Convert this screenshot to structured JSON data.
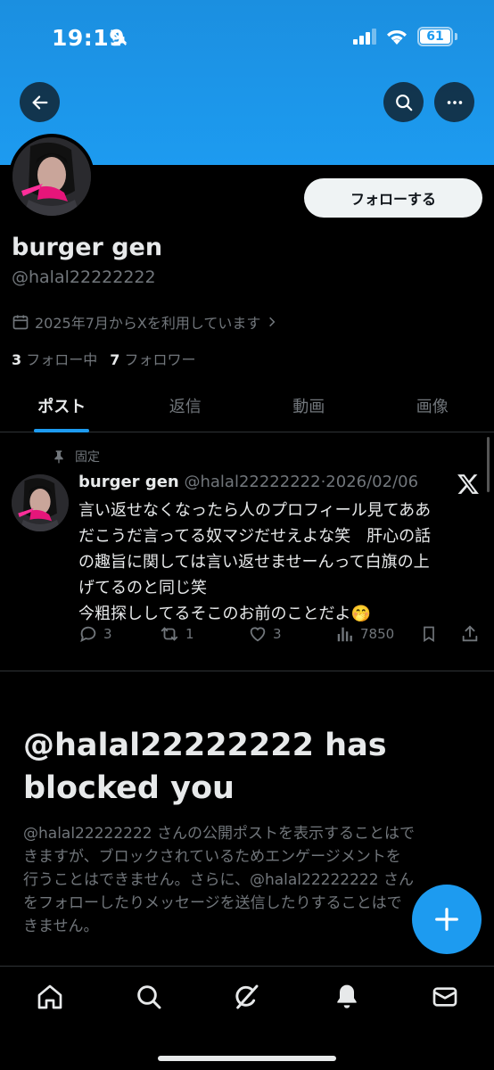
{
  "status_bar": {
    "time": "19:19",
    "battery": "61"
  },
  "profile": {
    "display_name": "burger gen",
    "handle": "@halal22222222",
    "joined": "2025年7月からXを利用しています",
    "following_count": "3",
    "following_label": "フォロー中",
    "followers_count": "7",
    "followers_label": "フォロワー",
    "follow_button": "フォローする"
  },
  "tabs": [
    {
      "label": "ポスト",
      "active": true
    },
    {
      "label": "返信",
      "active": false
    },
    {
      "label": "動画",
      "active": false
    },
    {
      "label": "画像",
      "active": false
    }
  ],
  "pinned_post": {
    "pinned_label": "固定",
    "author_name": "burger gen",
    "author_handle": "@halal22222222",
    "separator": "·",
    "date": "2026/02/06",
    "text_lines": [
      "言い返せなくなったら人のプロフィール見てああ",
      "だこうだ言ってる奴マジだせえよな笑　肝心の話",
      "の趣旨に関しては言い返せませーんって白旗の上",
      "げてるのと同じ笑",
      "今粗探ししてるそこのお前のことだよ🤭"
    ],
    "replies": "3",
    "reposts": "1",
    "likes": "3",
    "views": "7850"
  },
  "blocked_notice": {
    "title_lines": [
      "@halal22222222 has",
      "blocked you"
    ],
    "body_lines": [
      "@halal22222222 さんの公開ポストを表示することはで",
      "きますが、ブロックされているためエンゲージメントを",
      "行うことはできません。さらに、@halal22222222 さん",
      "をフォローしたりメッセージを送信したりすることはで",
      "きません。"
    ]
  },
  "colors": {
    "accent": "#1d9bf0",
    "background": "#000000",
    "muted": "#71767b",
    "text": "#e7e9ea"
  },
  "icons": {
    "back": "arrow-left-icon",
    "search": "search-icon",
    "more": "more-icon",
    "calendar": "calendar-icon",
    "pin": "pin-icon",
    "compose": "plus-icon",
    "nav": [
      "home-icon",
      "search-icon",
      "grok-icon",
      "bell-icon",
      "mail-icon"
    ]
  }
}
